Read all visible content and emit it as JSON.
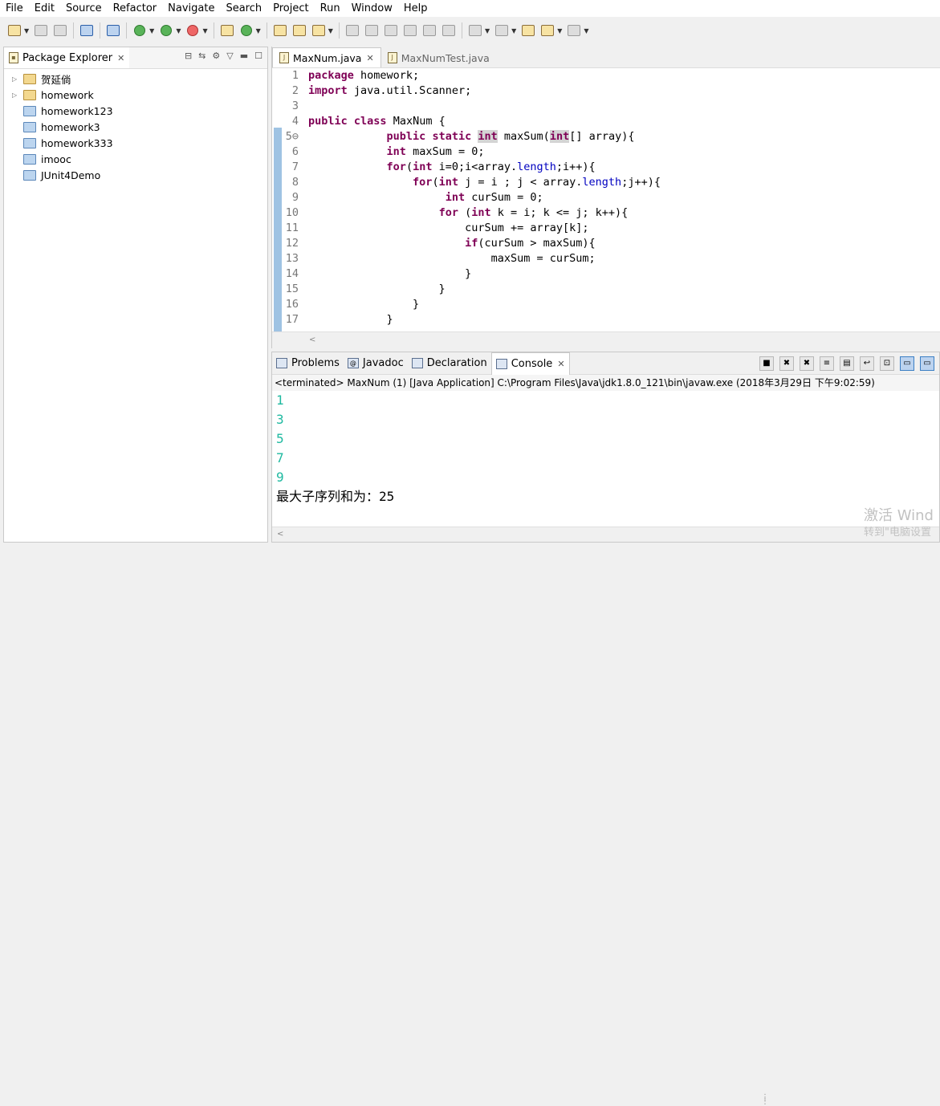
{
  "menu": [
    "File",
    "Edit",
    "Source",
    "Refactor",
    "Navigate",
    "Search",
    "Project",
    "Run",
    "Window",
    "Help"
  ],
  "package_explorer": {
    "title": "Package Explorer",
    "items": [
      {
        "label": "贺延倘",
        "expandable": true,
        "type": "project"
      },
      {
        "label": "homework",
        "expandable": true,
        "type": "project"
      },
      {
        "label": "homework123",
        "expandable": false,
        "type": "folder"
      },
      {
        "label": "homework3",
        "expandable": false,
        "type": "folder"
      },
      {
        "label": "homework333",
        "expandable": false,
        "type": "folder"
      },
      {
        "label": "imooc",
        "expandable": false,
        "type": "folder"
      },
      {
        "label": "JUnit4Demo",
        "expandable": false,
        "type": "folder"
      }
    ]
  },
  "editor": {
    "tabs": [
      {
        "label": "MaxNum.java",
        "active": true
      },
      {
        "label": "MaxNumTest.java",
        "active": false
      }
    ],
    "lines": [
      "package homework;",
      "import java.util.Scanner;",
      "",
      "public class MaxNum {",
      "            public static int maxSum(int[] array){",
      "            int maxSum = 0;",
      "            for(int i=0;i<array.length;i++){",
      "                for(int j = i ; j < array.length;j++){",
      "                     int curSum = 0;",
      "                    for (int k = i; k <= j; k++){",
      "                        curSum += array[k];",
      "                        if(curSum > maxSum){",
      "                            maxSum = curSum;",
      "                        }",
      "                    }",
      "                }",
      "            }"
    ]
  },
  "console": {
    "tabs": [
      "Problems",
      "Javadoc",
      "Declaration",
      "Console"
    ],
    "active_tab": "Console",
    "status": "<terminated> MaxNum (1) [Java Application] C:\\Program Files\\Java\\jdk1.8.0_121\\bin\\javaw.exe (2018年3月29日 下午9:02:59)",
    "output": [
      "1",
      "3",
      "5",
      "7",
      "9"
    ],
    "result": "最大子序列和为：25"
  },
  "watermark": {
    "line1": "激活 Wind",
    "line2": "转到\"电脑设置"
  },
  "colors": {
    "keyword": "#7f0055",
    "field": "#0000c0",
    "console_output": "#1fb9a0",
    "ruler": "#9fc3e3"
  }
}
